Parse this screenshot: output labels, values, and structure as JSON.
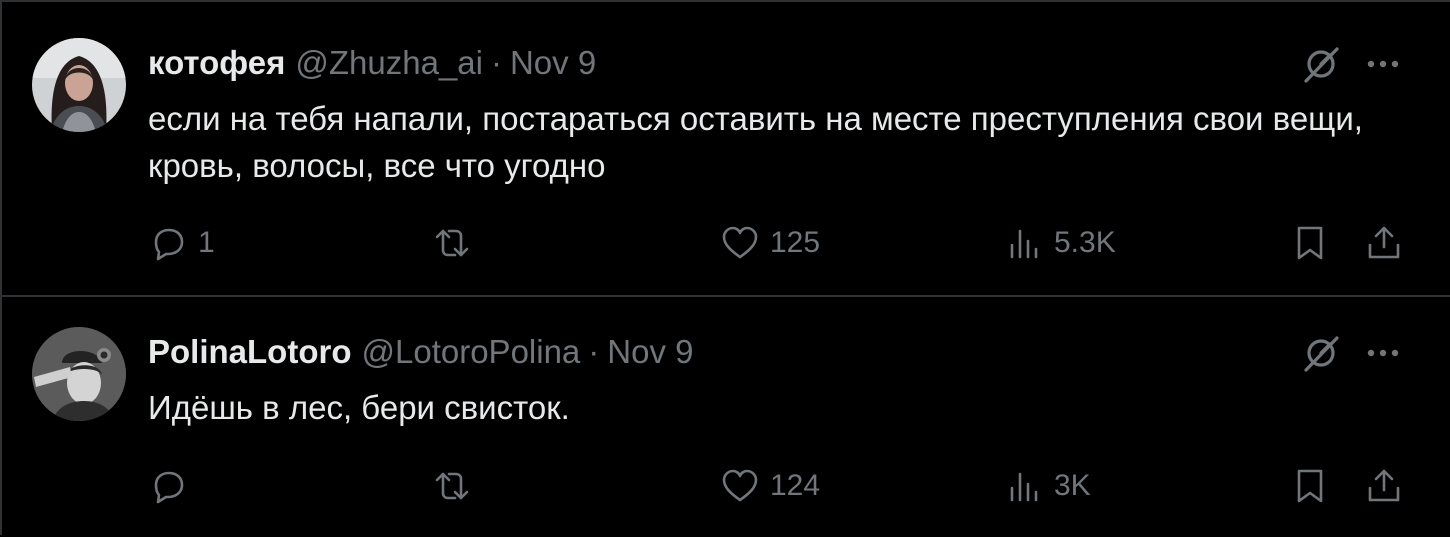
{
  "tweets": [
    {
      "display_name": "котофея",
      "handle": "@Zhuzha_ai",
      "separator": "·",
      "date": "Nov 9",
      "text": "если на тебя напали, постараться оставить на месте преступления свои вещи, кровь, волосы, все что угодно",
      "replies": "1",
      "retweets": "",
      "likes": "125",
      "views": "5.3K"
    },
    {
      "display_name": "PolinaLotoro",
      "handle": "@LotoroPolina",
      "separator": "·",
      "date": "Nov 9",
      "text": "Идёшь в лес, бери свисток.",
      "replies": "",
      "retweets": "",
      "likes": "124",
      "views": "3K"
    }
  ],
  "icons": {
    "grok": "grok-icon",
    "more": "more-icon",
    "reply": "reply-icon",
    "retweet": "retweet-icon",
    "like": "heart-icon",
    "views": "views-icon",
    "bookmark": "bookmark-icon",
    "share": "share-icon"
  },
  "colors": {
    "background": "#000000",
    "text_primary": "#e7e9ea",
    "text_secondary": "#71767b",
    "divider": "#2f3336"
  }
}
